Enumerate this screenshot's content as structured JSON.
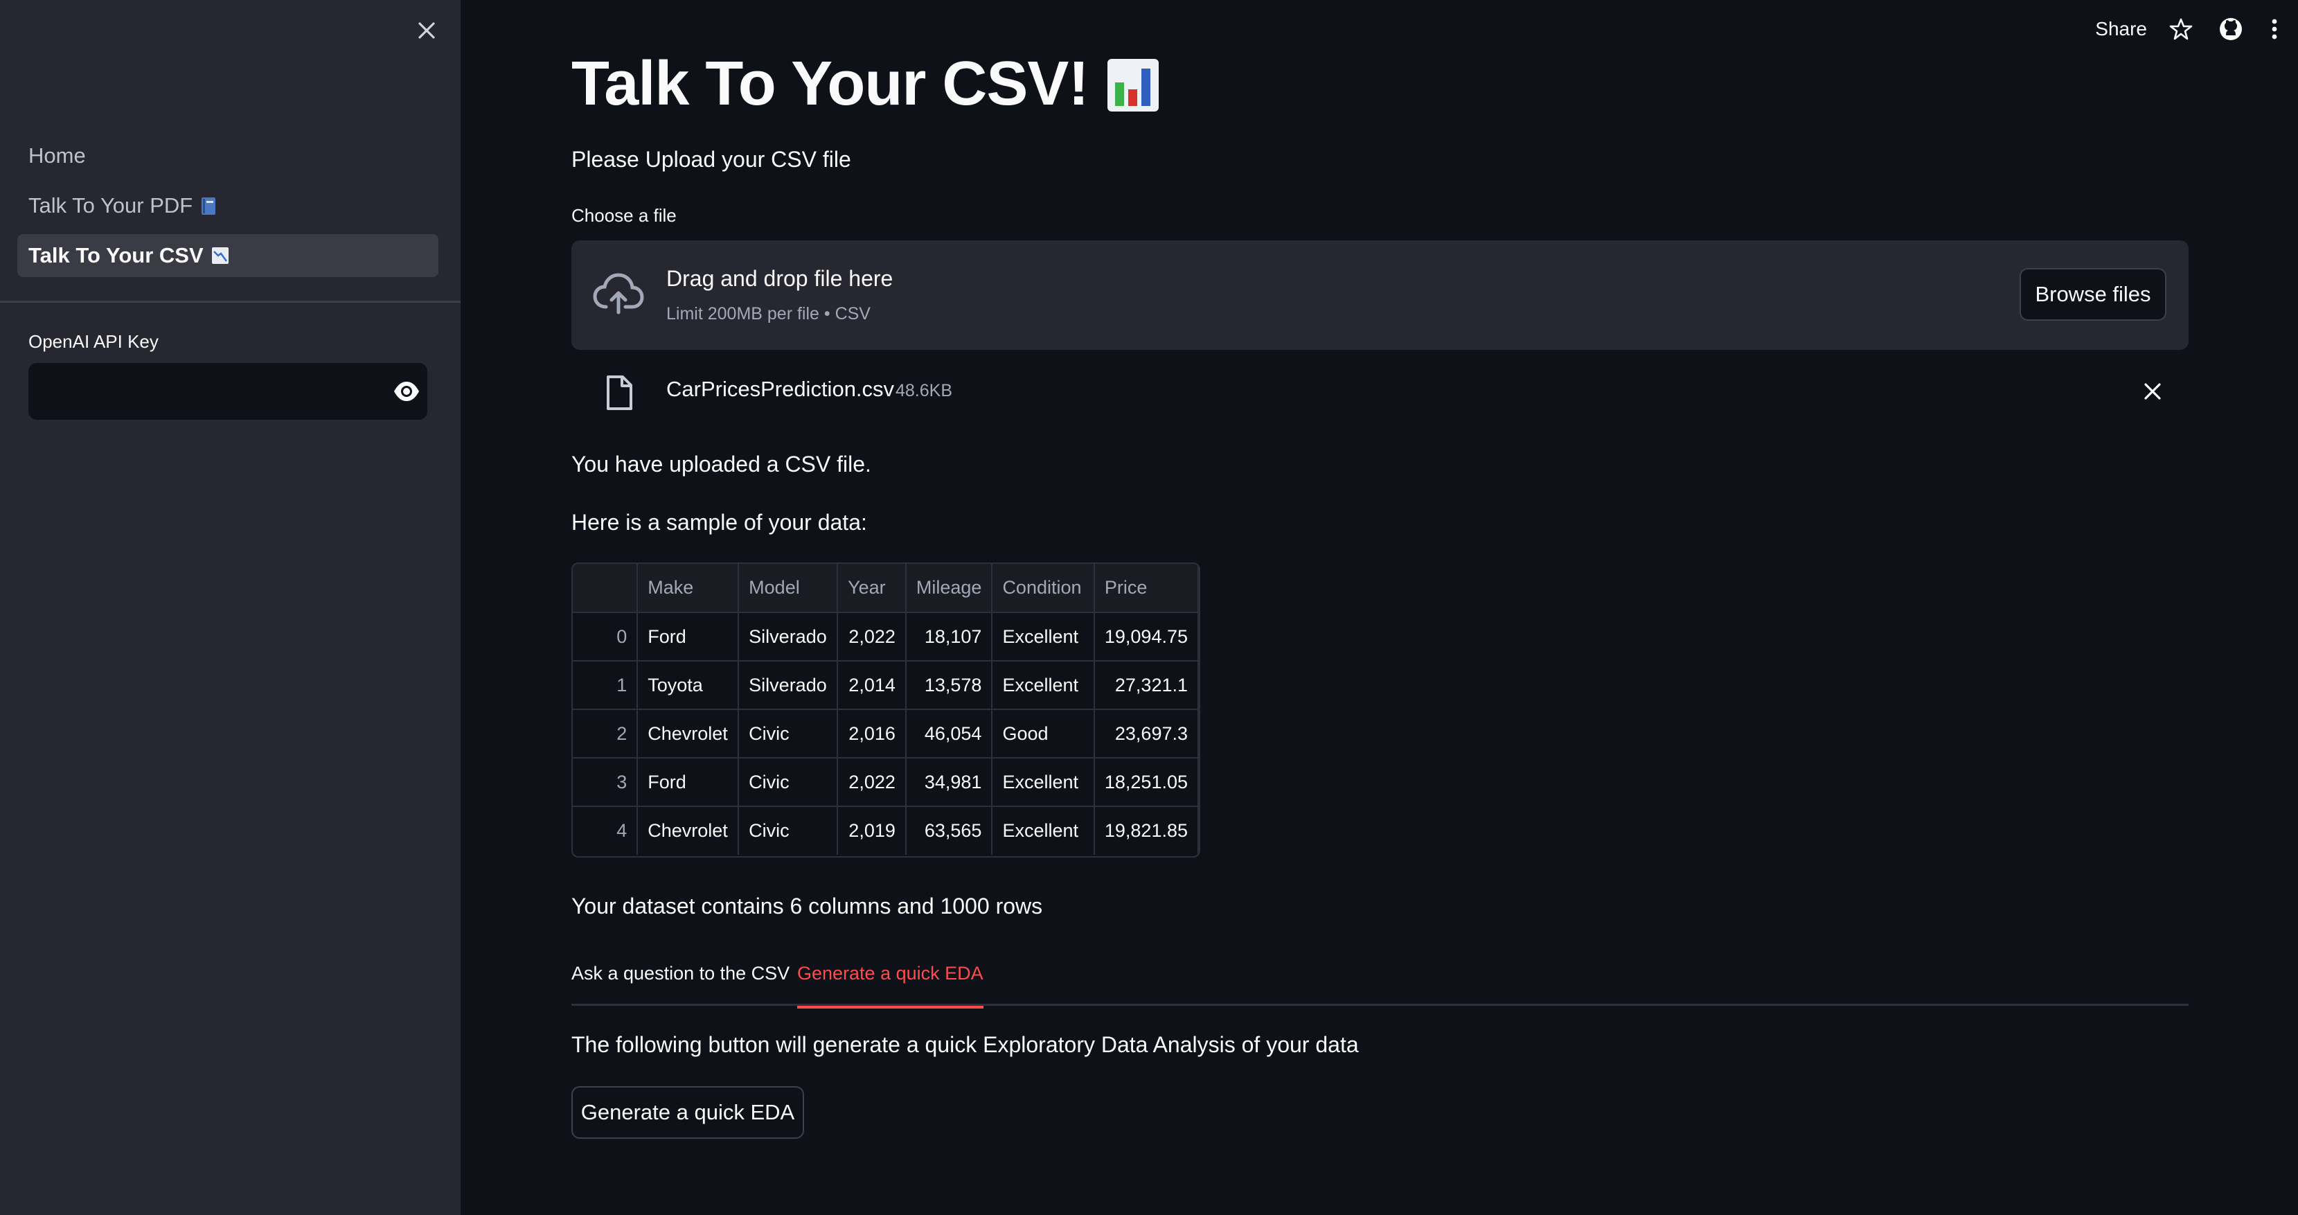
{
  "sidebar": {
    "nav_items": [
      {
        "label": "Home",
        "emoji": ""
      },
      {
        "label": "Talk To Your PDF",
        "emoji": "book-emoji"
      },
      {
        "label": "Talk To Your CSV",
        "emoji": "chart-emoji"
      }
    ],
    "active_index": 2,
    "api_key_label": "OpenAI API Key",
    "api_key_value": ""
  },
  "toolbar": {
    "share_label": "Share",
    "icons": [
      "star-icon",
      "github-icon",
      "more-vertical-icon"
    ]
  },
  "main": {
    "title": "Talk To Your CSV!",
    "title_emoji": "bar-chart-emoji",
    "upload_prompt": "Please Upload your CSV file",
    "choose_label": "Choose a file",
    "dropzone": {
      "title": "Drag and drop file here",
      "subtitle": "Limit 200MB per file • CSV",
      "browse_label": "Browse files"
    },
    "file": {
      "name": "CarPricesPrediction.csv",
      "size": "48.6KB"
    },
    "upload_message": "You have uploaded a CSV file.",
    "sample_message": "Here is a sample of your data:",
    "table": {
      "columns": [
        "",
        "Make",
        "Model",
        "Year",
        "Mileage",
        "Condition",
        "Price"
      ],
      "rows": [
        [
          "0",
          "Ford",
          "Silverado",
          "2,022",
          "18,107",
          "Excellent",
          "19,094.75"
        ],
        [
          "1",
          "Toyota",
          "Silverado",
          "2,014",
          "13,578",
          "Excellent",
          "27,321.1"
        ],
        [
          "2",
          "Chevrolet",
          "Civic",
          "2,016",
          "46,054",
          "Good",
          "23,697.3"
        ],
        [
          "3",
          "Ford",
          "Civic",
          "2,022",
          "34,981",
          "Excellent",
          "18,251.05"
        ],
        [
          "4",
          "Chevrolet",
          "Civic",
          "2,019",
          "63,565",
          "Excellent",
          "19,821.85"
        ]
      ]
    },
    "summary": "Your dataset contains 6 columns and 1000 rows",
    "tabs": [
      "Ask a question to the CSV",
      "Generate a quick EDA"
    ],
    "active_tab": 1,
    "eda_description": "The following button will generate a quick Exploratory Data Analysis of your data",
    "eda_button": "Generate a quick EDA"
  },
  "colors": {
    "background": "#0e1117",
    "sidebar": "#262730",
    "accent": "#ff4b4b"
  }
}
